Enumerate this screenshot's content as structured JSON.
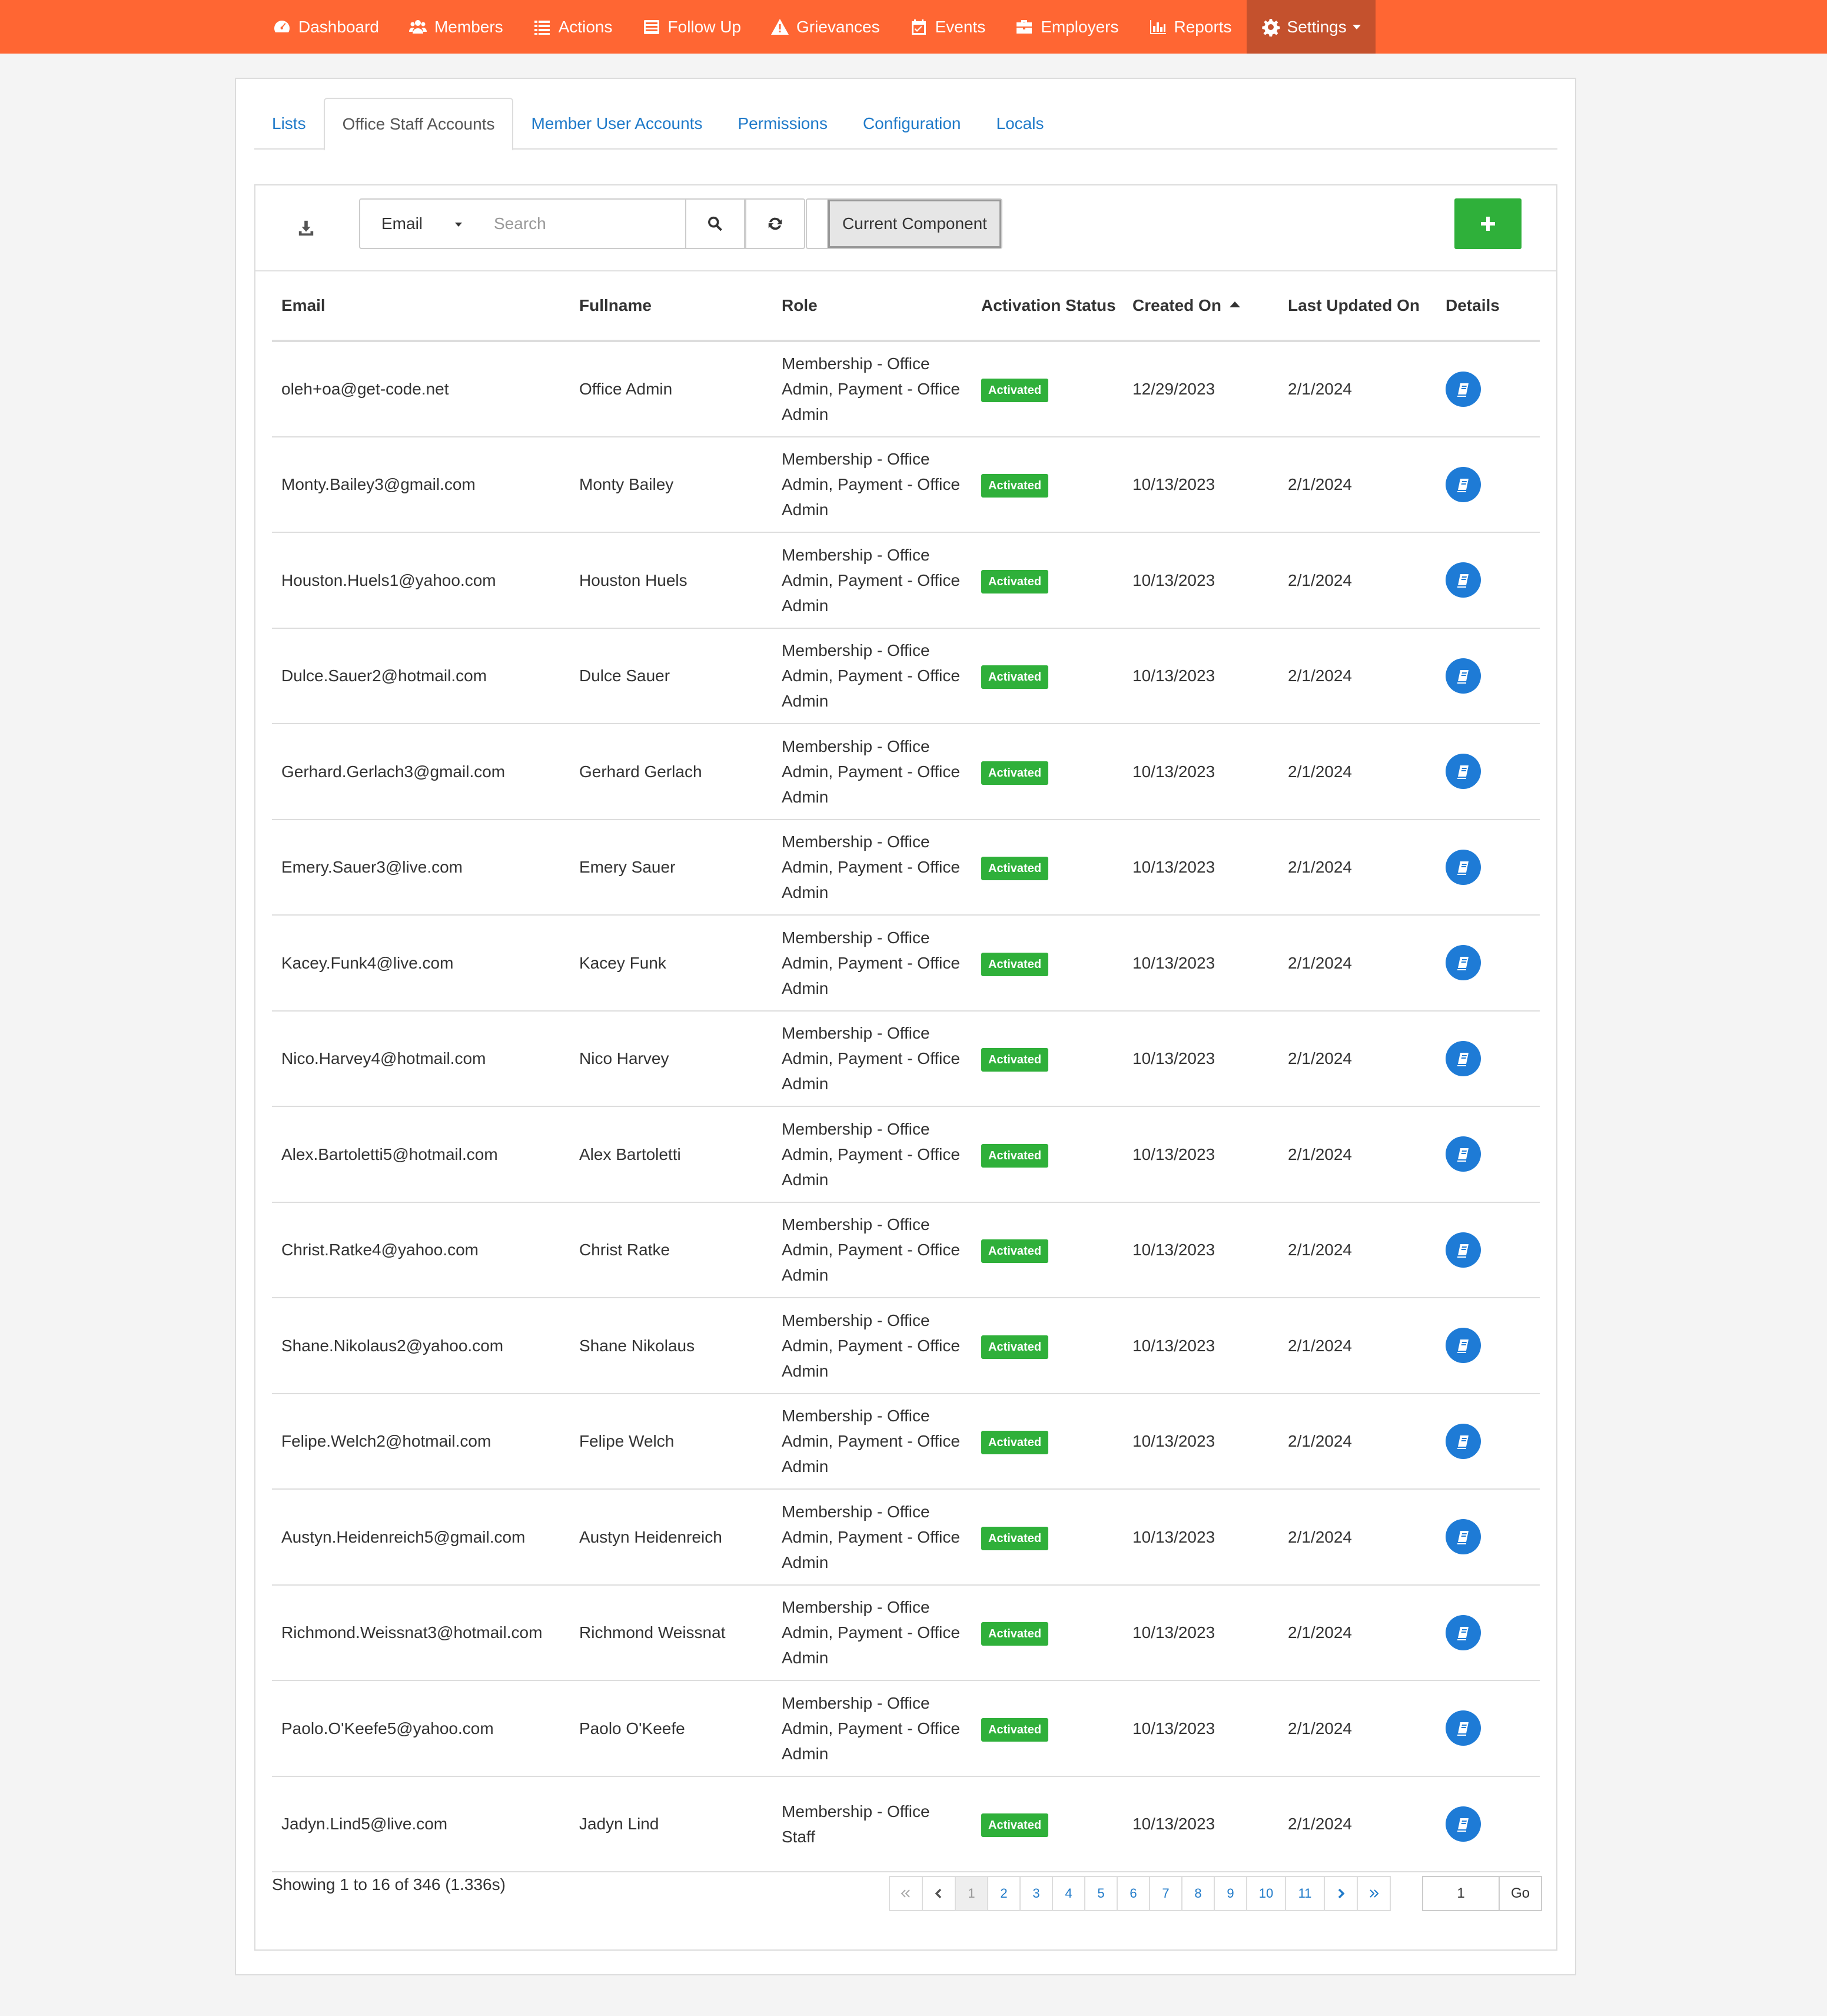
{
  "nav": {
    "items": [
      {
        "label": "Dashboard",
        "icon": "dashboard-icon"
      },
      {
        "label": "Members",
        "icon": "users-icon"
      },
      {
        "label": "Actions",
        "icon": "list-icon"
      },
      {
        "label": "Follow Up",
        "icon": "tasks-icon"
      },
      {
        "label": "Grievances",
        "icon": "warning-icon"
      },
      {
        "label": "Events",
        "icon": "calendar-icon"
      },
      {
        "label": "Employers",
        "icon": "briefcase-icon"
      },
      {
        "label": "Reports",
        "icon": "bar-chart-icon"
      },
      {
        "label": "Settings",
        "icon": "gear-icon",
        "active": true,
        "dropdown": true
      }
    ]
  },
  "tabs": [
    {
      "label": "Lists"
    },
    {
      "label": "Office Staff Accounts",
      "active": true
    },
    {
      "label": "Member User Accounts"
    },
    {
      "label": "Permissions"
    },
    {
      "label": "Configuration"
    },
    {
      "label": "Locals"
    }
  ],
  "toolbar": {
    "field_select": "Email",
    "search_placeholder": "Search",
    "component_toggle_label": "Current Component"
  },
  "table": {
    "columns": [
      "Email",
      "Fullname",
      "Role",
      "Activation Status",
      "Created On",
      "Last Updated On",
      "Details"
    ],
    "sort": {
      "column": "Created On",
      "direction": "asc"
    },
    "rows": [
      {
        "email": "oleh+oa@get-code.net",
        "fullname": "Office Admin",
        "role": "Membership - Office Admin, Payment - Office Admin",
        "status": "Activated",
        "created": "12/29/2023",
        "updated": "2/1/2024"
      },
      {
        "email": "Monty.Bailey3@gmail.com",
        "fullname": "Monty Bailey",
        "role": "Membership - Office Admin, Payment - Office Admin",
        "status": "Activated",
        "created": "10/13/2023",
        "updated": "2/1/2024"
      },
      {
        "email": "Houston.Huels1@yahoo.com",
        "fullname": "Houston Huels",
        "role": "Membership - Office Admin, Payment - Office Admin",
        "status": "Activated",
        "created": "10/13/2023",
        "updated": "2/1/2024"
      },
      {
        "email": "Dulce.Sauer2@hotmail.com",
        "fullname": "Dulce Sauer",
        "role": "Membership - Office Admin, Payment - Office Admin",
        "status": "Activated",
        "created": "10/13/2023",
        "updated": "2/1/2024"
      },
      {
        "email": "Gerhard.Gerlach3@gmail.com",
        "fullname": "Gerhard Gerlach",
        "role": "Membership - Office Admin, Payment - Office Admin",
        "status": "Activated",
        "created": "10/13/2023",
        "updated": "2/1/2024"
      },
      {
        "email": "Emery.Sauer3@live.com",
        "fullname": "Emery Sauer",
        "role": "Membership - Office Admin, Payment - Office Admin",
        "status": "Activated",
        "created": "10/13/2023",
        "updated": "2/1/2024"
      },
      {
        "email": "Kacey.Funk4@live.com",
        "fullname": "Kacey Funk",
        "role": "Membership - Office Admin, Payment - Office Admin",
        "status": "Activated",
        "created": "10/13/2023",
        "updated": "2/1/2024"
      },
      {
        "email": "Nico.Harvey4@hotmail.com",
        "fullname": "Nico Harvey",
        "role": "Membership - Office Admin, Payment - Office Admin",
        "status": "Activated",
        "created": "10/13/2023",
        "updated": "2/1/2024"
      },
      {
        "email": "Alex.Bartoletti5@hotmail.com",
        "fullname": "Alex Bartoletti",
        "role": "Membership - Office Admin, Payment - Office Admin",
        "status": "Activated",
        "created": "10/13/2023",
        "updated": "2/1/2024"
      },
      {
        "email": "Christ.Ratke4@yahoo.com",
        "fullname": "Christ Ratke",
        "role": "Membership - Office Admin, Payment - Office Admin",
        "status": "Activated",
        "created": "10/13/2023",
        "updated": "2/1/2024"
      },
      {
        "email": "Shane.Nikolaus2@yahoo.com",
        "fullname": "Shane Nikolaus",
        "role": "Membership - Office Admin, Payment - Office Admin",
        "status": "Activated",
        "created": "10/13/2023",
        "updated": "2/1/2024"
      },
      {
        "email": "Felipe.Welch2@hotmail.com",
        "fullname": "Felipe Welch",
        "role": "Membership - Office Admin, Payment - Office Admin",
        "status": "Activated",
        "created": "10/13/2023",
        "updated": "2/1/2024"
      },
      {
        "email": "Austyn.Heidenreich5@gmail.com",
        "fullname": "Austyn Heidenreich",
        "role": "Membership - Office Admin, Payment - Office Admin",
        "status": "Activated",
        "created": "10/13/2023",
        "updated": "2/1/2024"
      },
      {
        "email": "Richmond.Weissnat3@hotmail.com",
        "fullname": "Richmond Weissnat",
        "role": "Membership - Office Admin, Payment - Office Admin",
        "status": "Activated",
        "created": "10/13/2023",
        "updated": "2/1/2024"
      },
      {
        "email": "Paolo.O'Keefe5@yahoo.com",
        "fullname": "Paolo O'Keefe",
        "role": "Membership - Office Admin, Payment - Office Admin",
        "status": "Activated",
        "created": "10/13/2023",
        "updated": "2/1/2024"
      },
      {
        "email": "Jadyn.Lind5@live.com",
        "fullname": "Jadyn Lind",
        "role": "Membership - Office Staff",
        "status": "Activated",
        "created": "10/13/2023",
        "updated": "2/1/2024"
      }
    ]
  },
  "footer": {
    "showing_text": "Showing 1 to 16 of 346 (1.336s)",
    "pages": [
      "1",
      "2",
      "3",
      "4",
      "5",
      "6",
      "7",
      "8",
      "9",
      "10",
      "11"
    ],
    "current_page": "1",
    "goto_value": "1",
    "goto_label": "Go"
  },
  "colors": {
    "navbar": "#ff6633",
    "navbar_active": "#c4512d",
    "link": "#1f7ac9",
    "badge": "#2fb03a",
    "detail_button": "#1e7bd6"
  }
}
